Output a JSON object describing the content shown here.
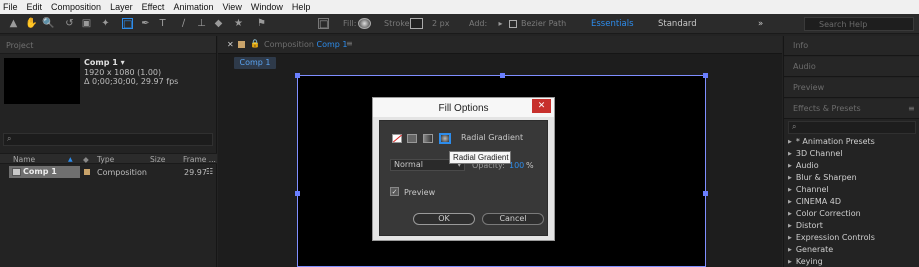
{
  "menu": [
    "File",
    "Edit",
    "Composition",
    "Layer",
    "Effect",
    "Animation",
    "View",
    "Window",
    "Help"
  ],
  "toolbar": {
    "fill_label": "Fill:",
    "stroke_label": "Stroke:",
    "stroke_px": "2 px",
    "add_label": "Add:",
    "bezier_label": "Bezier Path",
    "workspace_active": "Essentials",
    "workspace_other": "Standard",
    "search_placeholder": "Search Help"
  },
  "project": {
    "panel_title": "Project",
    "comp_name": "Comp 1 ▾",
    "comp_size": "1920 x 1080 (1.00)",
    "comp_duration": "Δ 0;00;30;00, 29.97 fps",
    "columns": [
      "Name",
      "Type",
      "Size",
      "Frame ..."
    ],
    "row": {
      "name": "Comp 1",
      "type": "Composition",
      "fps": "29.97"
    }
  },
  "composition": {
    "tab_prefix": "Composition",
    "tab_name": "Comp 1",
    "subtab": "Comp 1"
  },
  "dialog": {
    "title": "Fill Options",
    "close": "✕",
    "fill_type": "Radial Gradient",
    "blend_mode": "Normal",
    "opacity_label": "Opacity:",
    "opacity_value": "100",
    "opacity_unit": "%",
    "preview_label": "Preview",
    "preview_checked": true,
    "ok_label": "OK",
    "cancel_label": "Cancel",
    "tooltip": "Radial Gradient"
  },
  "right_panels": {
    "info": "Info",
    "audio": "Audio",
    "preview": "Preview",
    "effects": "Effects & Presets",
    "effect_items": [
      "* Animation Presets",
      "3D Channel",
      "Audio",
      "Blur & Sharpen",
      "Channel",
      "CINEMA 4D",
      "Color Correction",
      "Distort",
      "Expression Controls",
      "Generate",
      "Keying"
    ]
  },
  "colors": {
    "accent": "#2d8ceb",
    "close": "#c7302c",
    "canvas_border": "#7f8eff"
  }
}
